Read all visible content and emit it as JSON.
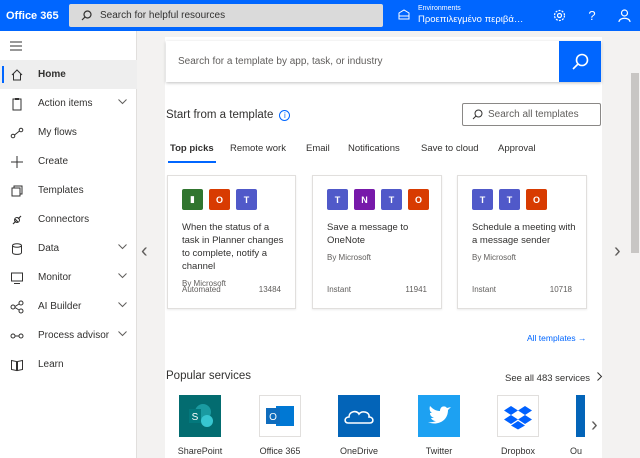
{
  "topbar": {
    "brand": "Office 365",
    "search_placeholder": "Search for helpful resources",
    "env_label": "Environments",
    "env_value": "Προεπιλεγμένο περιβά…"
  },
  "sidebar": {
    "items": [
      {
        "label": "Home",
        "icon": "home-icon",
        "chevron": false
      },
      {
        "label": "Action items",
        "icon": "clipboard-icon",
        "chevron": true
      },
      {
        "label": "My flows",
        "icon": "flow-icon",
        "chevron": false
      },
      {
        "label": "Create",
        "icon": "plus-icon",
        "chevron": false
      },
      {
        "label": "Templates",
        "icon": "templates-icon",
        "chevron": false
      },
      {
        "label": "Connectors",
        "icon": "connector-icon",
        "chevron": false
      },
      {
        "label": "Data",
        "icon": "database-icon",
        "chevron": true
      },
      {
        "label": "Monitor",
        "icon": "monitor-icon",
        "chevron": true
      },
      {
        "label": "AI Builder",
        "icon": "ai-icon",
        "chevron": true
      },
      {
        "label": "Process advisor",
        "icon": "process-icon",
        "chevron": true
      },
      {
        "label": "Learn",
        "icon": "book-icon",
        "chevron": false
      }
    ]
  },
  "main": {
    "template_search_placeholder": "Search for a template by app, task, or industry",
    "section_title": "Start from a template",
    "search_all_placeholder": "Search all templates",
    "tabs": [
      "Top picks",
      "Remote work",
      "Email",
      "Notifications",
      "Save to cloud",
      "Approval"
    ],
    "cards": [
      {
        "title": "When the status of a task in Planner changes to complete, notify a channel",
        "by": "By Microsoft",
        "by2": "Automated",
        "type": "",
        "count": "13484",
        "tiles": [
          {
            "color": "#31752f",
            "icon": "planner-icon"
          },
          {
            "color": "#d83b01",
            "icon": "office-icon"
          },
          {
            "color": "#5059c9",
            "icon": "teams-icon"
          }
        ]
      },
      {
        "title": "Save a message to OneNote",
        "by": "By Microsoft",
        "by2": "",
        "type": "Instant",
        "count": "11941",
        "tiles": [
          {
            "color": "#5059c9",
            "icon": "teams-icon"
          },
          {
            "color": "#7719aa",
            "icon": "onenote-icon"
          },
          {
            "color": "#5059c9",
            "icon": "teams-icon"
          },
          {
            "color": "#d83b01",
            "icon": "office-icon"
          }
        ]
      },
      {
        "title": "Schedule a meeting with a message sender",
        "by": "By Microsoft",
        "by2": "",
        "type": "Instant",
        "count": "10718",
        "tiles": [
          {
            "color": "#5059c9",
            "icon": "teams-icon"
          },
          {
            "color": "#5059c9",
            "icon": "teams-icon"
          },
          {
            "color": "#d83b01",
            "icon": "office-icon"
          }
        ]
      }
    ],
    "all_templates": "All templates →",
    "popular_title": "Popular services",
    "see_all": "See all 483 services",
    "services": [
      {
        "label": "SharePoint",
        "color": "#036c70",
        "icon": "sharepoint-icon"
      },
      {
        "label": "Office 365",
        "color": "#ffffff",
        "icon": "outlook-icon"
      },
      {
        "label": "OneDrive",
        "color": "#0364b8",
        "icon": "onedrive-icon"
      },
      {
        "label": "Twitter",
        "color": "#1da1f2",
        "icon": "twitter-icon"
      },
      {
        "label": "Dropbox",
        "color": "#ffffff",
        "icon": "dropbox-icon"
      },
      {
        "label": "Ou",
        "color": "#0364b8",
        "icon": "outlook-icon"
      }
    ]
  }
}
